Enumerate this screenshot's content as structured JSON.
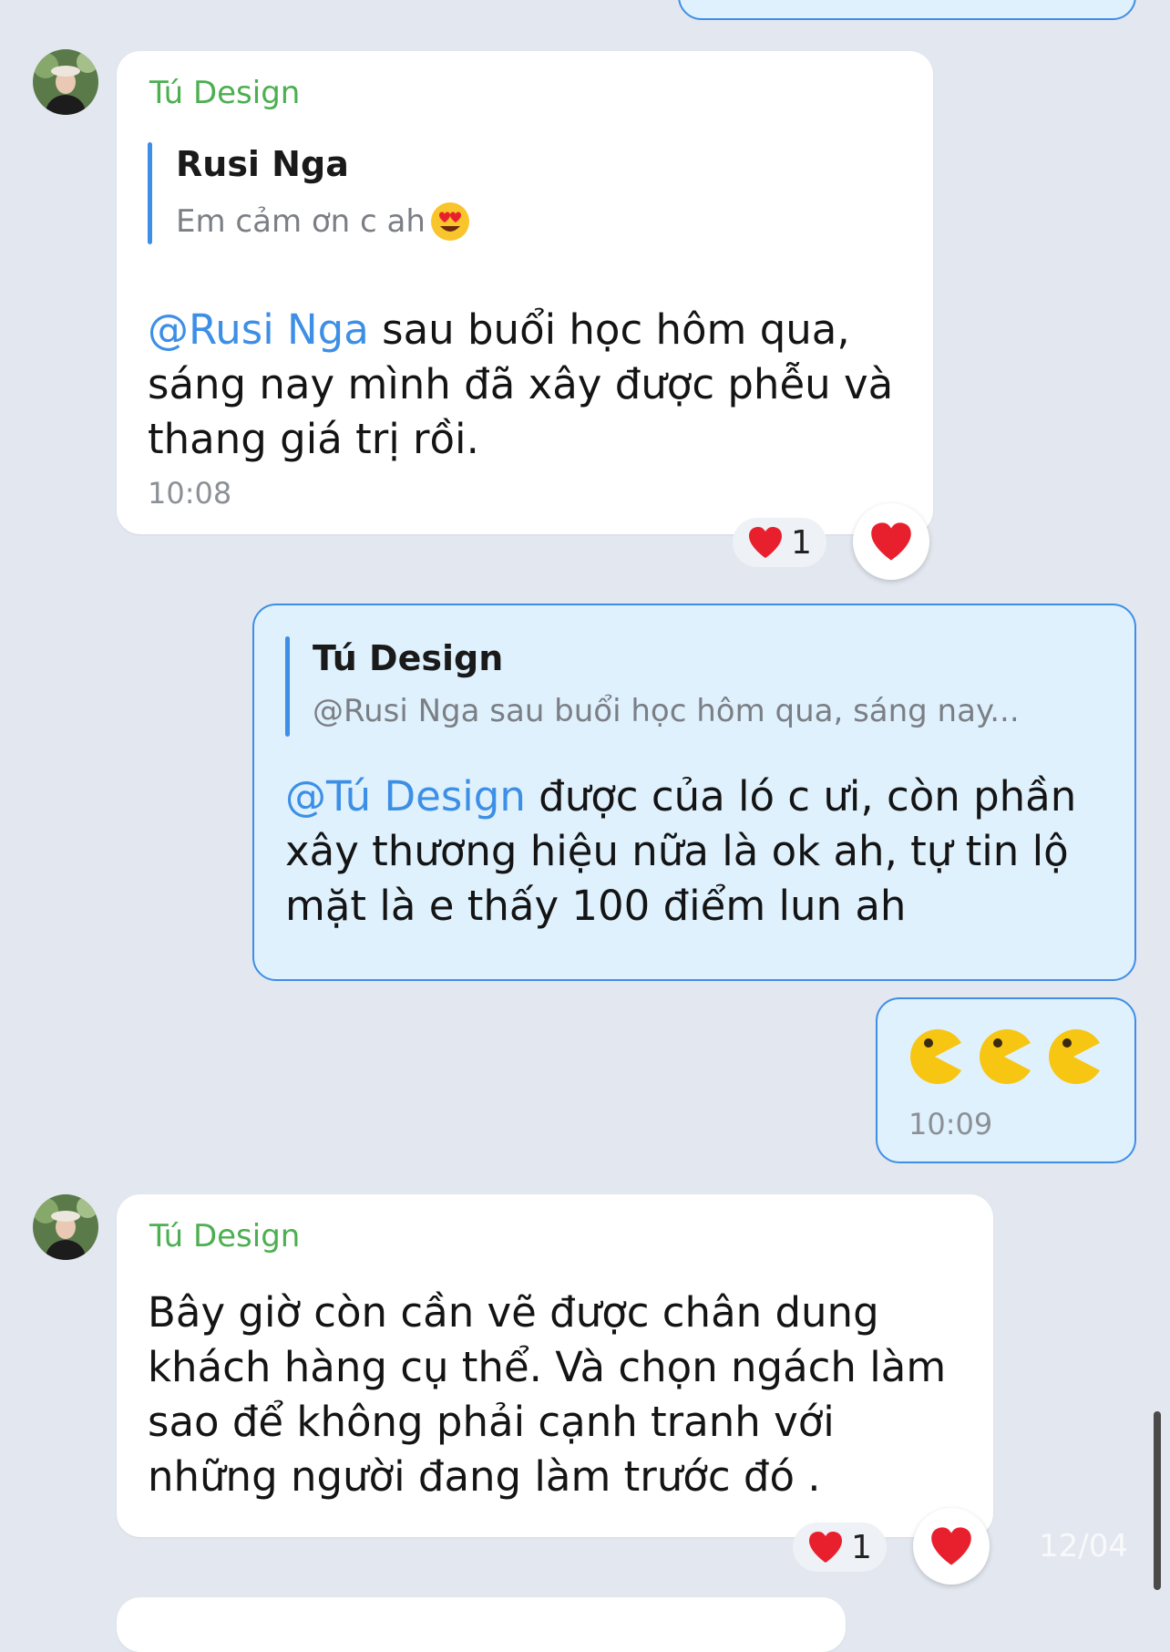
{
  "messages": [
    {
      "sender": "Tú Design",
      "quote": {
        "name": "Rusi Nga",
        "text": "Em cảm ơn c ah"
      },
      "mention": "@Rusi Nga",
      "text_line1": " sau buổi học hôm qua,",
      "text_line2": "sáng nay mình đã xây được phễu và",
      "text_line3": "thang giá trị rồi.",
      "time": "10:08",
      "reaction_count": "1"
    },
    {
      "quote": {
        "name": "Tú Design",
        "text": "@Rusi Nga sau buổi học hôm qua, sáng nay..."
      },
      "mention": "@Tú Design",
      "text_line1": " được của ló c ưi, còn phần",
      "text_line2": "xây thương hiệu nữa là ok ah, tự tin lộ",
      "text_line3": "mặt là e thấy 100 điểm lun ah"
    },
    {
      "time": "10:09"
    },
    {
      "sender": "Tú Design",
      "text_line1": "Bây giờ còn cần vẽ được chân dung",
      "text_line2": "khách hàng cụ thể. Và chọn ngách làm",
      "text_line3": "sao để không phải cạnh tranh với",
      "text_line4": "những người đang làm trước đó .",
      "reaction_count": "1"
    }
  ],
  "overlay_date": "12/04",
  "colors": {
    "background": "#e3e7ef",
    "incoming_bubble": "#ffffff",
    "outgoing_bubble": "#dff1fd",
    "outgoing_border": "#3f8ee6",
    "sender_name": "#4caf50",
    "mention": "#3d8fe6",
    "heart": "#e8202e"
  },
  "icons": [
    "avatar",
    "heart-eyes-emoji",
    "heart-icon",
    "pacman-emoji"
  ]
}
